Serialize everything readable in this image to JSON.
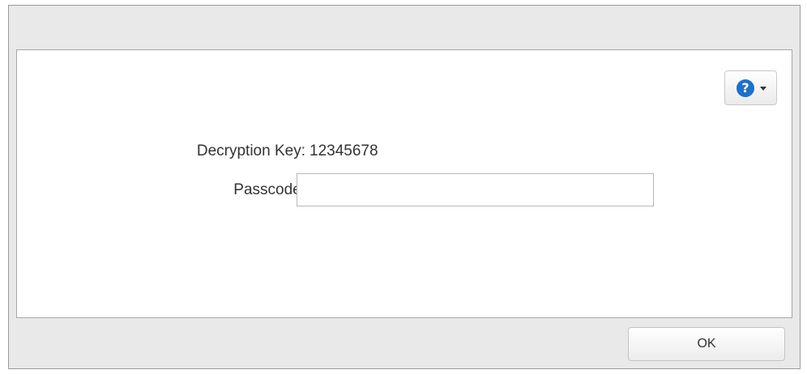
{
  "dialog": {
    "help": {
      "icon": "help-icon",
      "glyph": "?",
      "menu_icon": "chevron-down-icon",
      "accent_color": "#1f6fcc"
    },
    "fields": {
      "decryption_key": {
        "label": "Decryption Key:",
        "value": "12345678"
      },
      "passcode": {
        "label": "Passcode:",
        "value": "",
        "placeholder": ""
      }
    },
    "ok_label": "OK"
  }
}
